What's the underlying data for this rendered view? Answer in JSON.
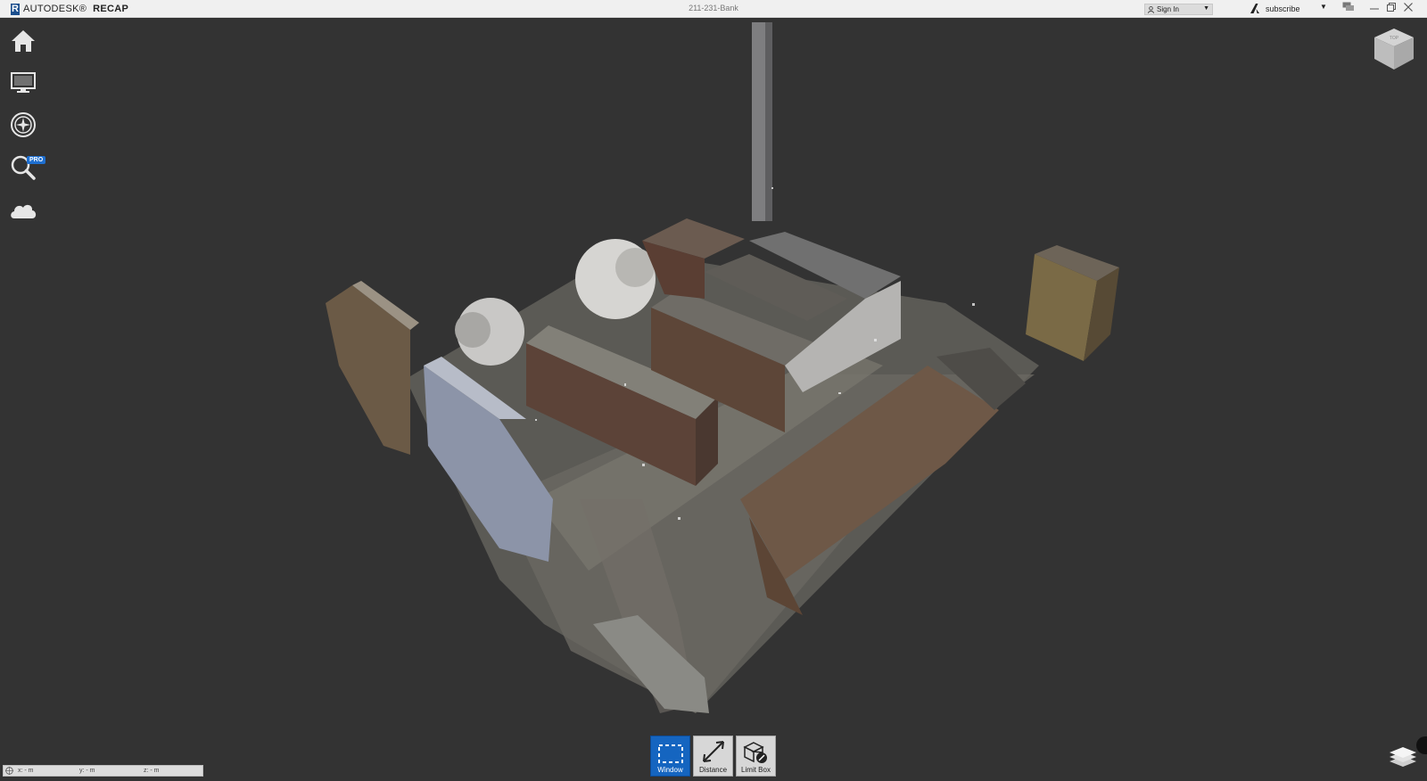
{
  "titlebar": {
    "brand_logo": "R",
    "brand_autodesk": "AUTODESK®",
    "brand_product": "RECAP",
    "document_title": "211-231-Bank",
    "sign_in_label": "Sign In",
    "subscribe_label": "subscribe"
  },
  "left_toolbar": {
    "items": [
      {
        "name": "home-icon"
      },
      {
        "name": "display-icon"
      },
      {
        "name": "navigation-icon"
      },
      {
        "name": "search-icon"
      },
      {
        "name": "cloud-icon"
      }
    ],
    "pro_badge": "PRO"
  },
  "bottom_tools": {
    "window_label": "Window",
    "distance_label": "Distance",
    "limitbox_label": "Limit Box",
    "active": "Window"
  },
  "coordinates": {
    "x": "x: - m",
    "y": "y: - m",
    "z": "z: - m"
  },
  "colors": {
    "viewport_bg": "#333333",
    "titlebar_bg": "#f0f0f0",
    "accent": "#1565c0"
  }
}
